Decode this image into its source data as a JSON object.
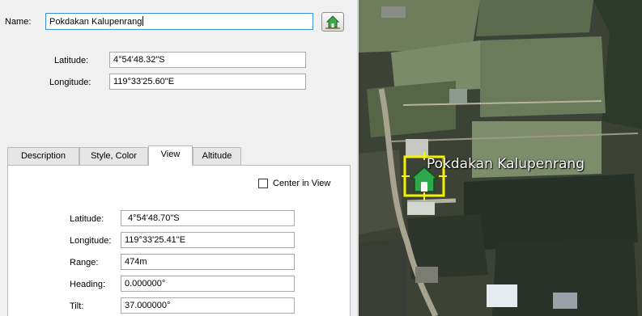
{
  "name": {
    "label": "Name:",
    "value": "Pokdakan Kalupenrang"
  },
  "location": {
    "latitude_label": "Latitude:",
    "latitude_value": "4°54'48.32\"S",
    "longitude_label": "Longitude:",
    "longitude_value": "119°33'25.60\"E"
  },
  "tabs": [
    "Description",
    "Style, Color",
    "View",
    "Altitude"
  ],
  "active_tab": "View",
  "view": {
    "center_label": "Center in View",
    "center_checked": false,
    "latitude_label": "Latitude:",
    "latitude_value": "4°54'48.70\"S",
    "longitude_label": "Longitude:",
    "longitude_value": "119°33'25.41\"E",
    "range_label": "Range:",
    "range_value": "474m",
    "heading_label": "Heading:",
    "heading_value": "0.000000°",
    "tilt_label": "Tilt:",
    "tilt_value": "37.000000°"
  },
  "map": {
    "placemark_label": "Pokdakan Kalupenrang",
    "placemark_icon": "house-icon",
    "icon_color": "#2ea84a"
  },
  "icons": {
    "icon_button": "house-icon"
  }
}
